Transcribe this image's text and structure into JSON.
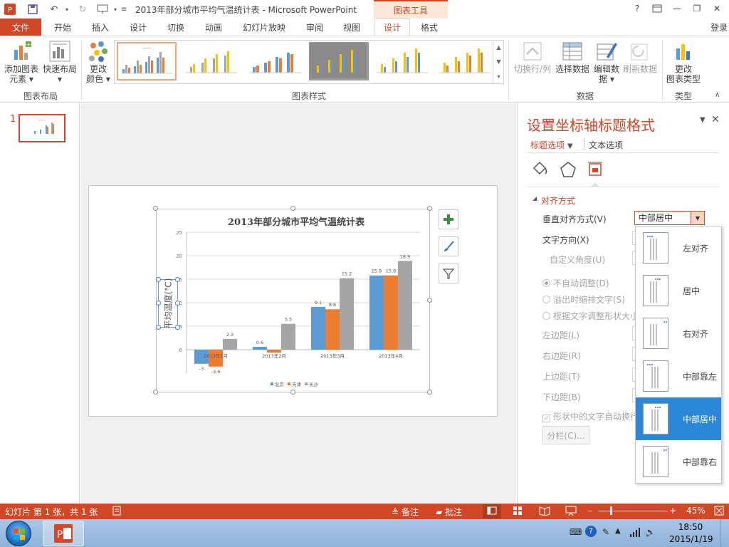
{
  "window": {
    "title": "2013年部分城市平均气温统计表 - Microsoft PowerPoint",
    "context_tab": "图表工具",
    "help": "?",
    "min": "—",
    "restore": "❐",
    "close": "✕",
    "signin": "登录"
  },
  "tabs": {
    "file": "文件",
    "items": [
      "开始",
      "插入",
      "设计",
      "切换",
      "动画",
      "幻灯片放映",
      "审阅",
      "视图",
      "设计",
      "格式"
    ]
  },
  "ribbon": {
    "add_element": [
      "添加图表",
      "元素 ▾"
    ],
    "quick_layout": [
      "快速布局",
      "▾"
    ],
    "change_color": [
      "更改",
      "颜色 ▾"
    ],
    "switch_rowcol": "切换行/列",
    "select_data": "选择数据",
    "edit_data": [
      "编辑数",
      "据 ▾"
    ],
    "refresh_data": "刷新数据",
    "change_type": [
      "更改",
      "图表类型"
    ],
    "groups": [
      "图表布局",
      "图表样式",
      "数据",
      "类型"
    ]
  },
  "slides": {
    "number": "1"
  },
  "chart_data": {
    "type": "bar",
    "title": "2013年部分城市平均气温统计表",
    "ylabel": "平均温度(℃)",
    "xlabel": "",
    "categories": [
      "2013年1月",
      "2013年2月",
      "2013年3月",
      "2013年4月"
    ],
    "ylim": [
      -5,
      25
    ],
    "yticks": [
      "25",
      "20",
      "15",
      "10",
      "5",
      "0"
    ],
    "series": [
      {
        "name": "北京",
        "color": "#5b9bd5",
        "values": [
          -3,
          0.6,
          9.1,
          15.8
        ]
      },
      {
        "name": "天津",
        "color": "#ed7d31",
        "values": [
          -3.6,
          -0.6,
          8.6,
          15.8
        ]
      },
      {
        "name": "长沙",
        "color": "#a5a5a5",
        "values": [
          2.3,
          5.5,
          15.2,
          18.9
        ]
      }
    ],
    "labels": [
      [
        "-3",
        "0.6",
        "9.1",
        "15.8"
      ],
      [
        "-3.6",
        "",
        "8.6",
        "15.8"
      ],
      [
        "2.3",
        "5.5",
        "15.2",
        "18.9"
      ]
    ],
    "legend_position": "bottom",
    "grid": true
  },
  "pane": {
    "title": "设置坐标轴标题格式",
    "tab_title_options": "标题选项",
    "tab_text_options": "文本选项",
    "section": "对齐方式",
    "vertical_align_label": "垂直对齐方式(V)",
    "vertical_align_value": "中部居中",
    "text_direction": "文字方向(X)",
    "custom_angle": "自定义角度(U)",
    "no_autofit": "不自动调整(D)",
    "shrink_on_overflow": "溢出时缩排文字(S)",
    "resize_shape": "根据文字调整形状大小",
    "left_margin": "左边距(L)",
    "right_margin": "右边距(R)",
    "top_margin": "上边距(T)",
    "bottom_margin": "下边距(B)",
    "wrap_text": "形状中的文字自动换行",
    "columns": "分栏(C)..."
  },
  "dropdown": {
    "options": [
      "左对齐",
      "居中",
      "右对齐",
      "中部靠左",
      "中部居中",
      "中部靠右"
    ],
    "selected_index": 4
  },
  "status": {
    "slide_info": "幻灯片 第 1 张，共 1 张",
    "notes": "备注",
    "comments": "批注",
    "zoom": "45%"
  },
  "taskbar": {
    "time": "18:50",
    "date": "2015/1/19"
  }
}
